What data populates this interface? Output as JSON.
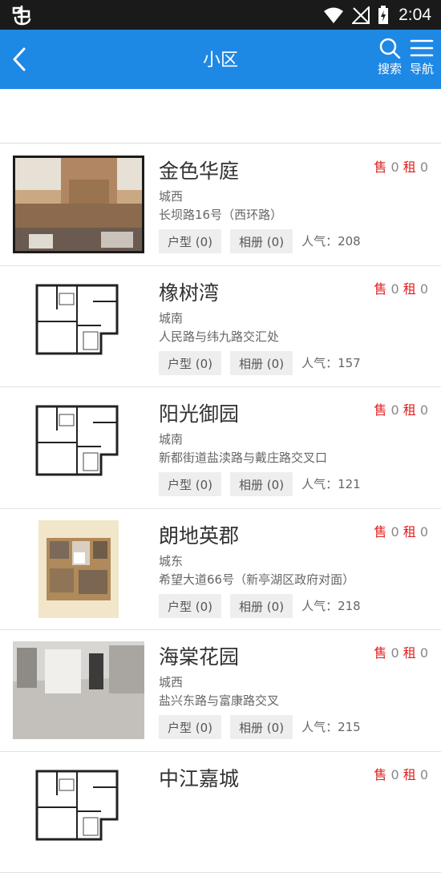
{
  "status_bar": {
    "time": "2:04"
  },
  "header": {
    "title": "小区",
    "search_label": "搜索",
    "nav_label": "导航"
  },
  "labels": {
    "sale": "售",
    "rent": "租",
    "layout_tag": "户型 (0)",
    "album_tag": "相册 (0)",
    "popularity": "人气："
  },
  "colors": {
    "header": "#1e88e5",
    "sale_rent": "#e02020"
  },
  "communities": [
    {
      "name": "金色华庭",
      "district": "城西",
      "address": "长坝路16号（西环路）",
      "sale": "0",
      "rent": "0",
      "popularity": "208",
      "thumb": "building-photo"
    },
    {
      "name": "橡树湾",
      "district": "城南",
      "address": "人民路与纬九路交汇处",
      "sale": "0",
      "rent": "0",
      "popularity": "157",
      "thumb": "floor-plan"
    },
    {
      "name": "阳光御园",
      "district": "城南",
      "address": "新都街道盐渎路与戴庄路交叉口",
      "sale": "0",
      "rent": "0",
      "popularity": "121",
      "thumb": "floor-plan"
    },
    {
      "name": "朗地英郡",
      "district": "城东",
      "address": "希望大道66号（新亭湖区政府对面）",
      "sale": "0",
      "rent": "0",
      "popularity": "218",
      "thumb": "color-floor-plan"
    },
    {
      "name": "海棠花园",
      "district": "城西",
      "address": "盐兴东路与富康路交叉",
      "sale": "0",
      "rent": "0",
      "popularity": "215",
      "thumb": "room-photo"
    },
    {
      "name": "中江嘉城",
      "district": "",
      "address": "",
      "sale": "0",
      "rent": "0",
      "popularity": "",
      "thumb": "floor-plan"
    }
  ]
}
